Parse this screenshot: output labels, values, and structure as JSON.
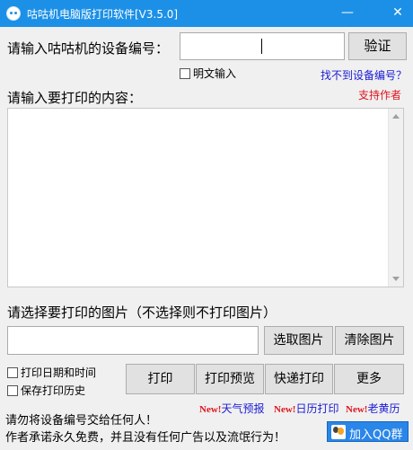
{
  "window": {
    "title": "咕咕机电脑版打印软件[V3.5.0]",
    "minimize_glyph": "—",
    "close_glyph": "✕"
  },
  "device": {
    "label": "请输入咕咕机的设备编号：",
    "value": "",
    "verify_button": "验证",
    "show_plain_label": "明文输入",
    "show_plain_checked": false,
    "cant_find_link": "找不到设备编号？"
  },
  "content": {
    "label": "请输入要打印的内容：",
    "support_link": "支持作者",
    "text": ""
  },
  "image": {
    "label": "请选择要打印的图片（不选择则不打印图片）",
    "path": "",
    "choose_button": "选取图片",
    "clear_button": "清除图片"
  },
  "options": {
    "print_datetime": {
      "label": "打印日期和时间",
      "checked": false
    },
    "save_history": {
      "label": "保存打印历史",
      "checked": false
    }
  },
  "actions": {
    "print": "打印",
    "preview": "打印预览",
    "quick_print": "快递打印",
    "more": "更多"
  },
  "extras": {
    "new_tag": "New!",
    "weather": "天气预报",
    "calendar": "日历打印",
    "almanac": "老黄历"
  },
  "footer": {
    "warning": "请勿将设备编号交给任何人！",
    "promise": "作者承诺永久免费，并且没有任何广告以及流氓行为！",
    "qq_button": "加入QQ群"
  },
  "colors": {
    "titlebar": "#1c90e6",
    "link_blue": "#1a1ad6",
    "link_red": "#e0141e",
    "qq_button": "#2a86e8"
  }
}
